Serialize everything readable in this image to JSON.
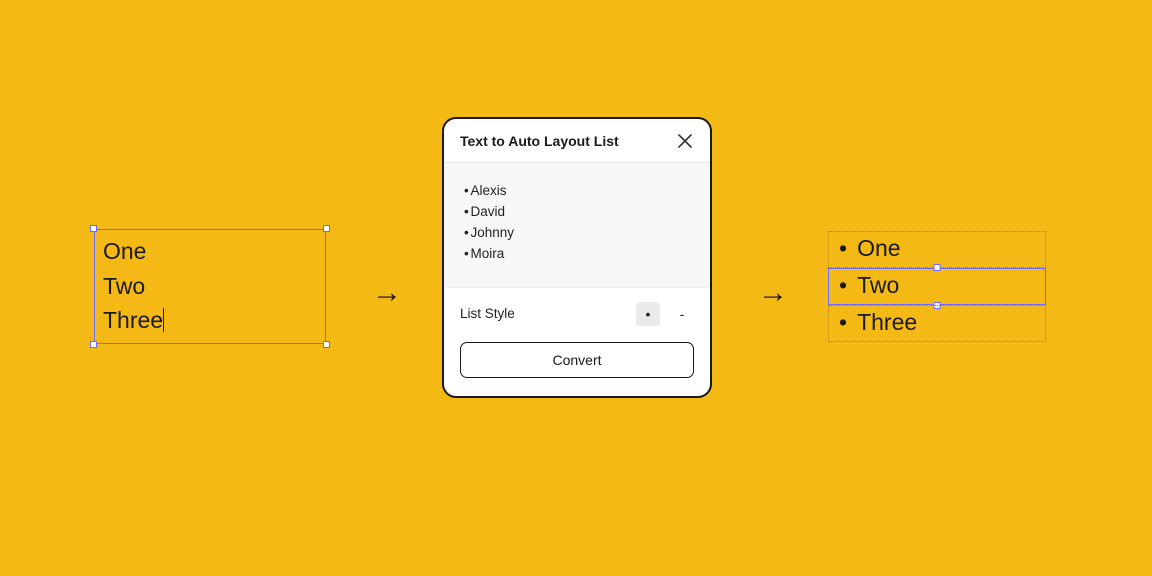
{
  "input_text": {
    "lines": [
      "One",
      "Two",
      "Three"
    ]
  },
  "arrow_glyph": "→",
  "dialog": {
    "title": "Text to Auto Layout List",
    "preview_items": [
      "Alexis",
      "David",
      "Johnny",
      "Moira"
    ],
    "list_style_label": "List Style",
    "style_options": {
      "bullet": "•",
      "dash": "-"
    },
    "selected_style": "bullet",
    "convert_label": "Convert"
  },
  "output_list": {
    "items": [
      "One",
      "Two",
      "Three"
    ],
    "selected_index": 1
  }
}
